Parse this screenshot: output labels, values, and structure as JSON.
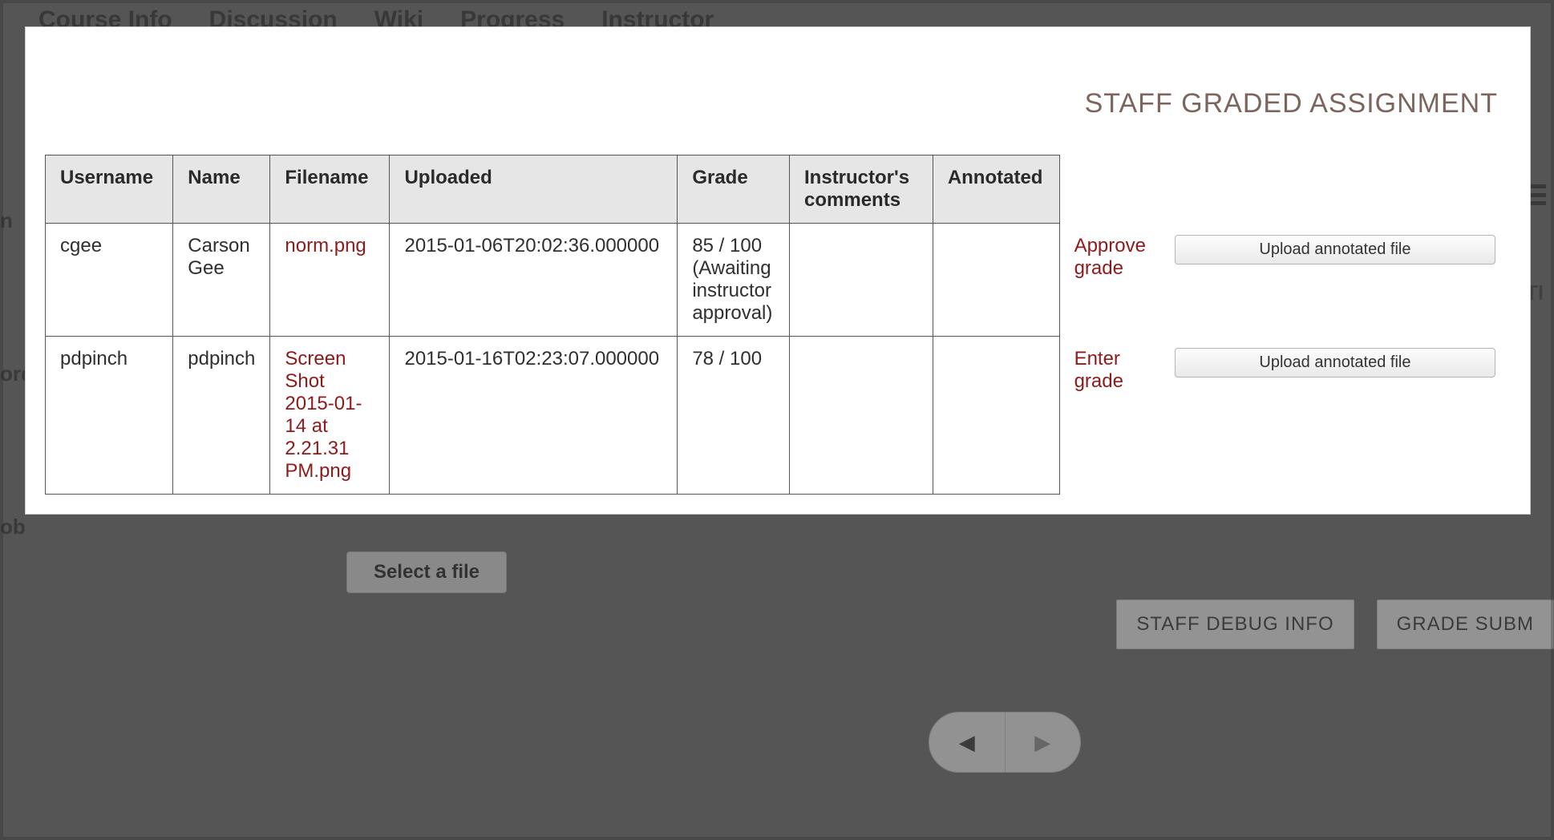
{
  "nav": {
    "items": [
      "Course Info",
      "Discussion",
      "Wiki",
      "Progress",
      "Instructor"
    ]
  },
  "sidebar_fragments": [
    "n",
    "ord",
    "ob"
  ],
  "right_hint": "TI",
  "bg": {
    "select_file": "Select a file",
    "staff_debug": "STAFF DEBUG INFO",
    "grade_subm": "GRADE SUBM"
  },
  "modal": {
    "title": "STAFF GRADED ASSIGNMENT",
    "headers": {
      "username": "Username",
      "name": "Name",
      "filename": "Filename",
      "uploaded": "Uploaded",
      "grade": "Grade",
      "comments": "Instructor's comments",
      "annotated": "Annotated"
    },
    "upload_label": "Upload annotated file",
    "rows": [
      {
        "username": "cgee",
        "name": "Carson Gee",
        "filename": "norm.png",
        "uploaded": "2015-01-06T20:02:36.000000",
        "grade": "85 / 100 (Awaiting instructor approval)",
        "comments": "",
        "annotated": "",
        "action": "Approve grade"
      },
      {
        "username": "pdpinch",
        "name": "pdpinch",
        "filename": "Screen Shot 2015-01-14 at 2.21.31 PM.png",
        "uploaded": "2015-01-16T02:23:07.000000",
        "grade": "78 / 100",
        "comments": "",
        "annotated": "",
        "action": "Enter grade"
      }
    ]
  }
}
